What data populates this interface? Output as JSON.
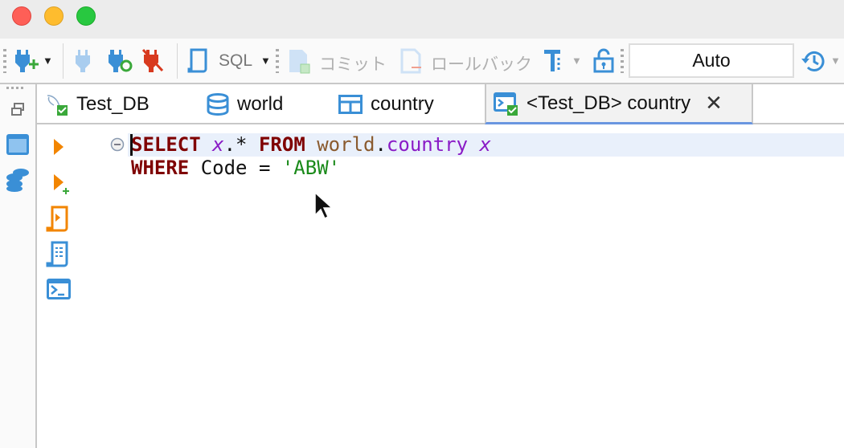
{
  "window": {
    "controls": [
      "close",
      "minimize",
      "maximize"
    ]
  },
  "toolbar": {
    "sql_label": "SQL",
    "commit_label": "コミット",
    "rollback_label": "ロールバック",
    "transaction_mode": "Auto"
  },
  "tabs": [
    {
      "label": "Test_DB",
      "icon": "mysql-connection-icon"
    },
    {
      "label": "world",
      "icon": "database-icon"
    },
    {
      "label": "country",
      "icon": "table-icon"
    },
    {
      "label": "<Test_DB> country",
      "icon": "sql-console-icon",
      "active": true
    }
  ],
  "editor": {
    "line1": {
      "kw1": "SELECT",
      "alias1": "x",
      "dotstar": ".*",
      "sp1": " ",
      "kw2": "FROM",
      "schema": "world",
      "dot": ".",
      "table": "country",
      "alias2": "x"
    },
    "line2": {
      "kw": "WHERE",
      "rest": " Code = ",
      "str": "'ABW'"
    }
  },
  "colors": {
    "keyword": "#7f0000",
    "alias": "#8a1bc6",
    "string": "#1a8a1a",
    "accent": "#3a8fd6"
  }
}
